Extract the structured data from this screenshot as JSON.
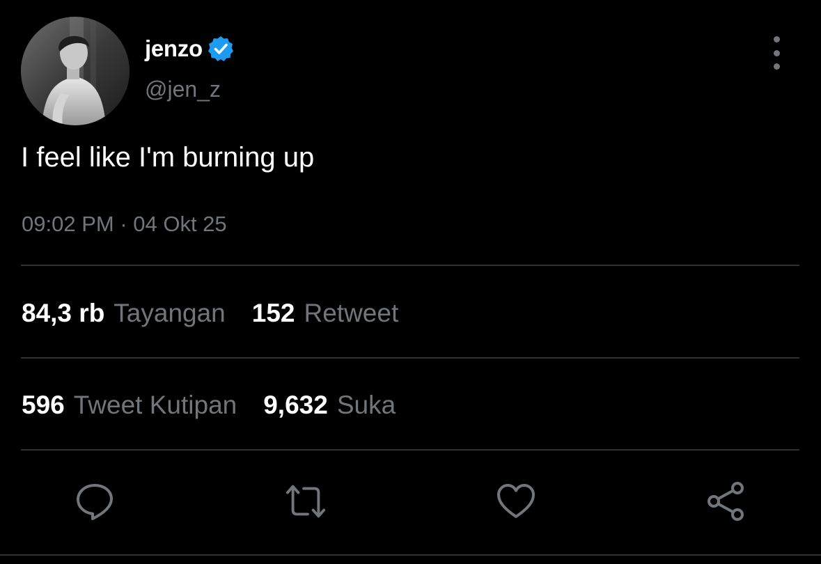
{
  "author": {
    "display_name": "jenzo",
    "handle": "@jen_z",
    "verified": true,
    "verified_color": "#1d9bf0"
  },
  "tweet": {
    "text": "I feel like I'm burning up",
    "timestamp": "09:02 PM · 04 Okt 25"
  },
  "stats": {
    "views": {
      "value": "84,3 rb",
      "label": "Tayangan"
    },
    "retweets": {
      "value": "152",
      "label": "Retweet"
    },
    "quotes": {
      "value": "596",
      "label": "Tweet Kutipan"
    },
    "likes": {
      "value": "9,632",
      "label": "Suka"
    }
  },
  "actions": [
    {
      "icon": "reply-icon"
    },
    {
      "icon": "retweet-icon"
    },
    {
      "icon": "like-icon"
    },
    {
      "icon": "share-icon"
    }
  ],
  "colors": {
    "background": "#000000",
    "primary_text": "#ffffff",
    "secondary_text": "#71767b",
    "divider": "#2f3336"
  }
}
